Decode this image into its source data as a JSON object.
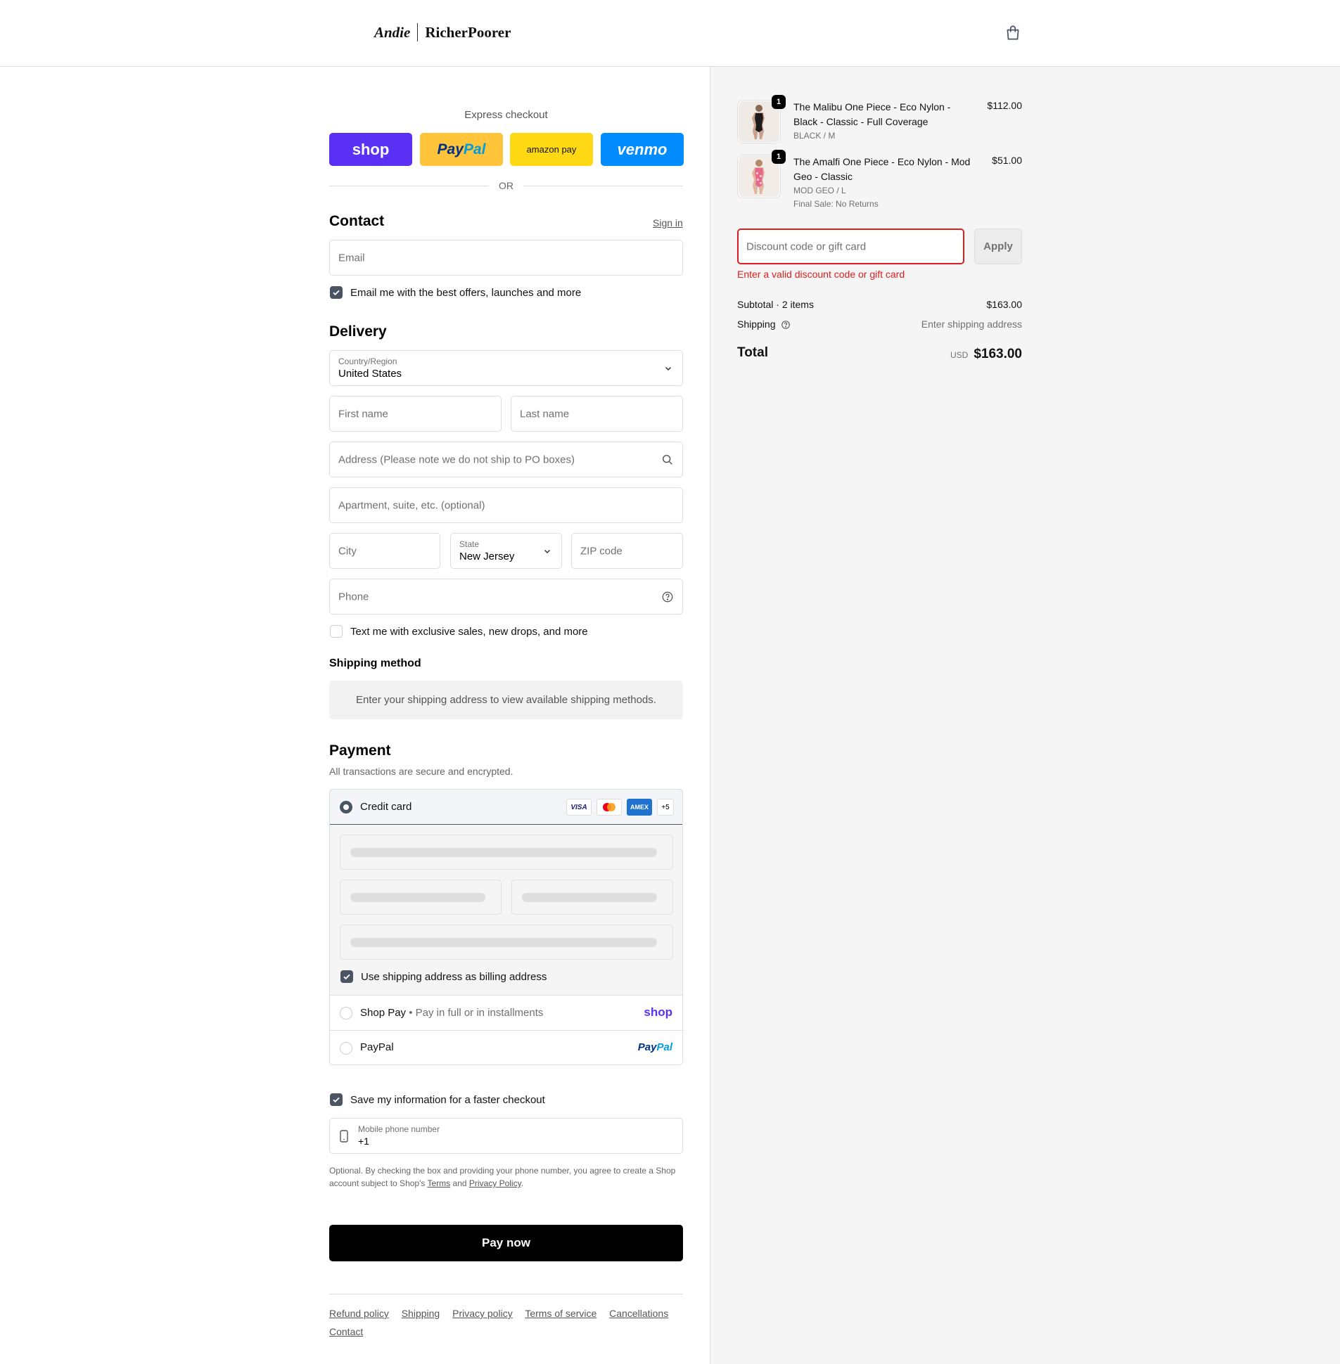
{
  "header": {
    "logo_left": "Andie",
    "logo_right": "RicherPoorer"
  },
  "express": {
    "title": "Express checkout",
    "shop_label": "shop",
    "paypal_pay": "Pay",
    "paypal_pal": "Pal",
    "amazon_label": "amazon pay",
    "venmo_label": "venmo",
    "or_label": "OR"
  },
  "contact": {
    "heading": "Contact",
    "sign_in": "Sign in",
    "email_placeholder": "Email",
    "offers_label": "Email me with the best offers, launches and more",
    "offers_checked": true
  },
  "delivery": {
    "heading": "Delivery",
    "country_label": "Country/Region",
    "country_value": "United States",
    "first_name": "First name",
    "last_name": "Last name",
    "address": "Address (Please note we do not ship to PO boxes)",
    "apartment": "Apartment, suite, etc. (optional)",
    "city": "City",
    "state_label": "State",
    "state_value": "New Jersey",
    "zip": "ZIP code",
    "phone": "Phone",
    "sms_label": "Text me with exclusive sales, new drops, and more",
    "sms_checked": false
  },
  "shipping_method": {
    "heading": "Shipping method",
    "message": "Enter your shipping address to view available shipping methods."
  },
  "payment": {
    "heading": "Payment",
    "subtitle": "All transactions are secure and encrypted.",
    "credit_card_label": "Credit card",
    "card_logos": [
      "VISA",
      "mastercard",
      "AMEX"
    ],
    "more_cards": "+5",
    "billing_label": "Use shipping address as billing address",
    "billing_checked": true,
    "shop_pay_label": "Shop Pay",
    "shop_pay_note": "Pay in full or in installments",
    "shop_pay_logo": "shop",
    "paypal_label": "PayPal",
    "paypal_logo_pay": "Pay",
    "paypal_logo_pal": "Pal"
  },
  "remember": {
    "label": "Save my information for a faster checkout",
    "checked": true,
    "phone_label": "Mobile phone number",
    "phone_value": "+1",
    "fine_print_1": "Optional. By checking the box and providing your phone number, you agree to create a Shop account subject to Shop's",
    "terms": "Terms",
    "and": "and",
    "privacy": "Privacy Policy",
    "period": "."
  },
  "pay_now": "Pay now",
  "footer": {
    "links": [
      "Refund policy",
      "Shipping",
      "Privacy policy",
      "Terms of service",
      "Cancellations",
      "Contact"
    ]
  },
  "order": {
    "items": [
      {
        "qty": "1",
        "name": "The Malibu One Piece - Eco Nylon - Black - Classic - Full Coverage",
        "variant": "BLACK / M",
        "note": "",
        "price": "$112.00"
      },
      {
        "qty": "1",
        "name": "The Amalfi One Piece - Eco Nylon - Mod Geo - Classic",
        "variant": "MOD GEO / L",
        "note": "Final Sale: No Returns",
        "price": "$51.00"
      }
    ],
    "discount_placeholder": "Discount code or gift card",
    "apply": "Apply",
    "discount_error": "Enter a valid discount code or gift card",
    "subtotal_label": "Subtotal · 2 items",
    "subtotal_value": "$163.00",
    "shipping_label": "Shipping",
    "shipping_value": "Enter shipping address",
    "total_label": "Total",
    "currency": "USD",
    "total_value": "$163.00"
  },
  "colors": {
    "accent": "#4a5463",
    "error": "#dd1d1d",
    "shop_purple": "#5a31f4",
    "paypal_yellow": "#ffc439",
    "amazon_yellow": "#ffd814",
    "venmo_blue": "#008cff"
  },
  "icons": [
    "shopping-bag-icon",
    "chevron-down-icon",
    "search-icon",
    "help-circle-icon",
    "check-icon",
    "mobile-phone-icon"
  ]
}
